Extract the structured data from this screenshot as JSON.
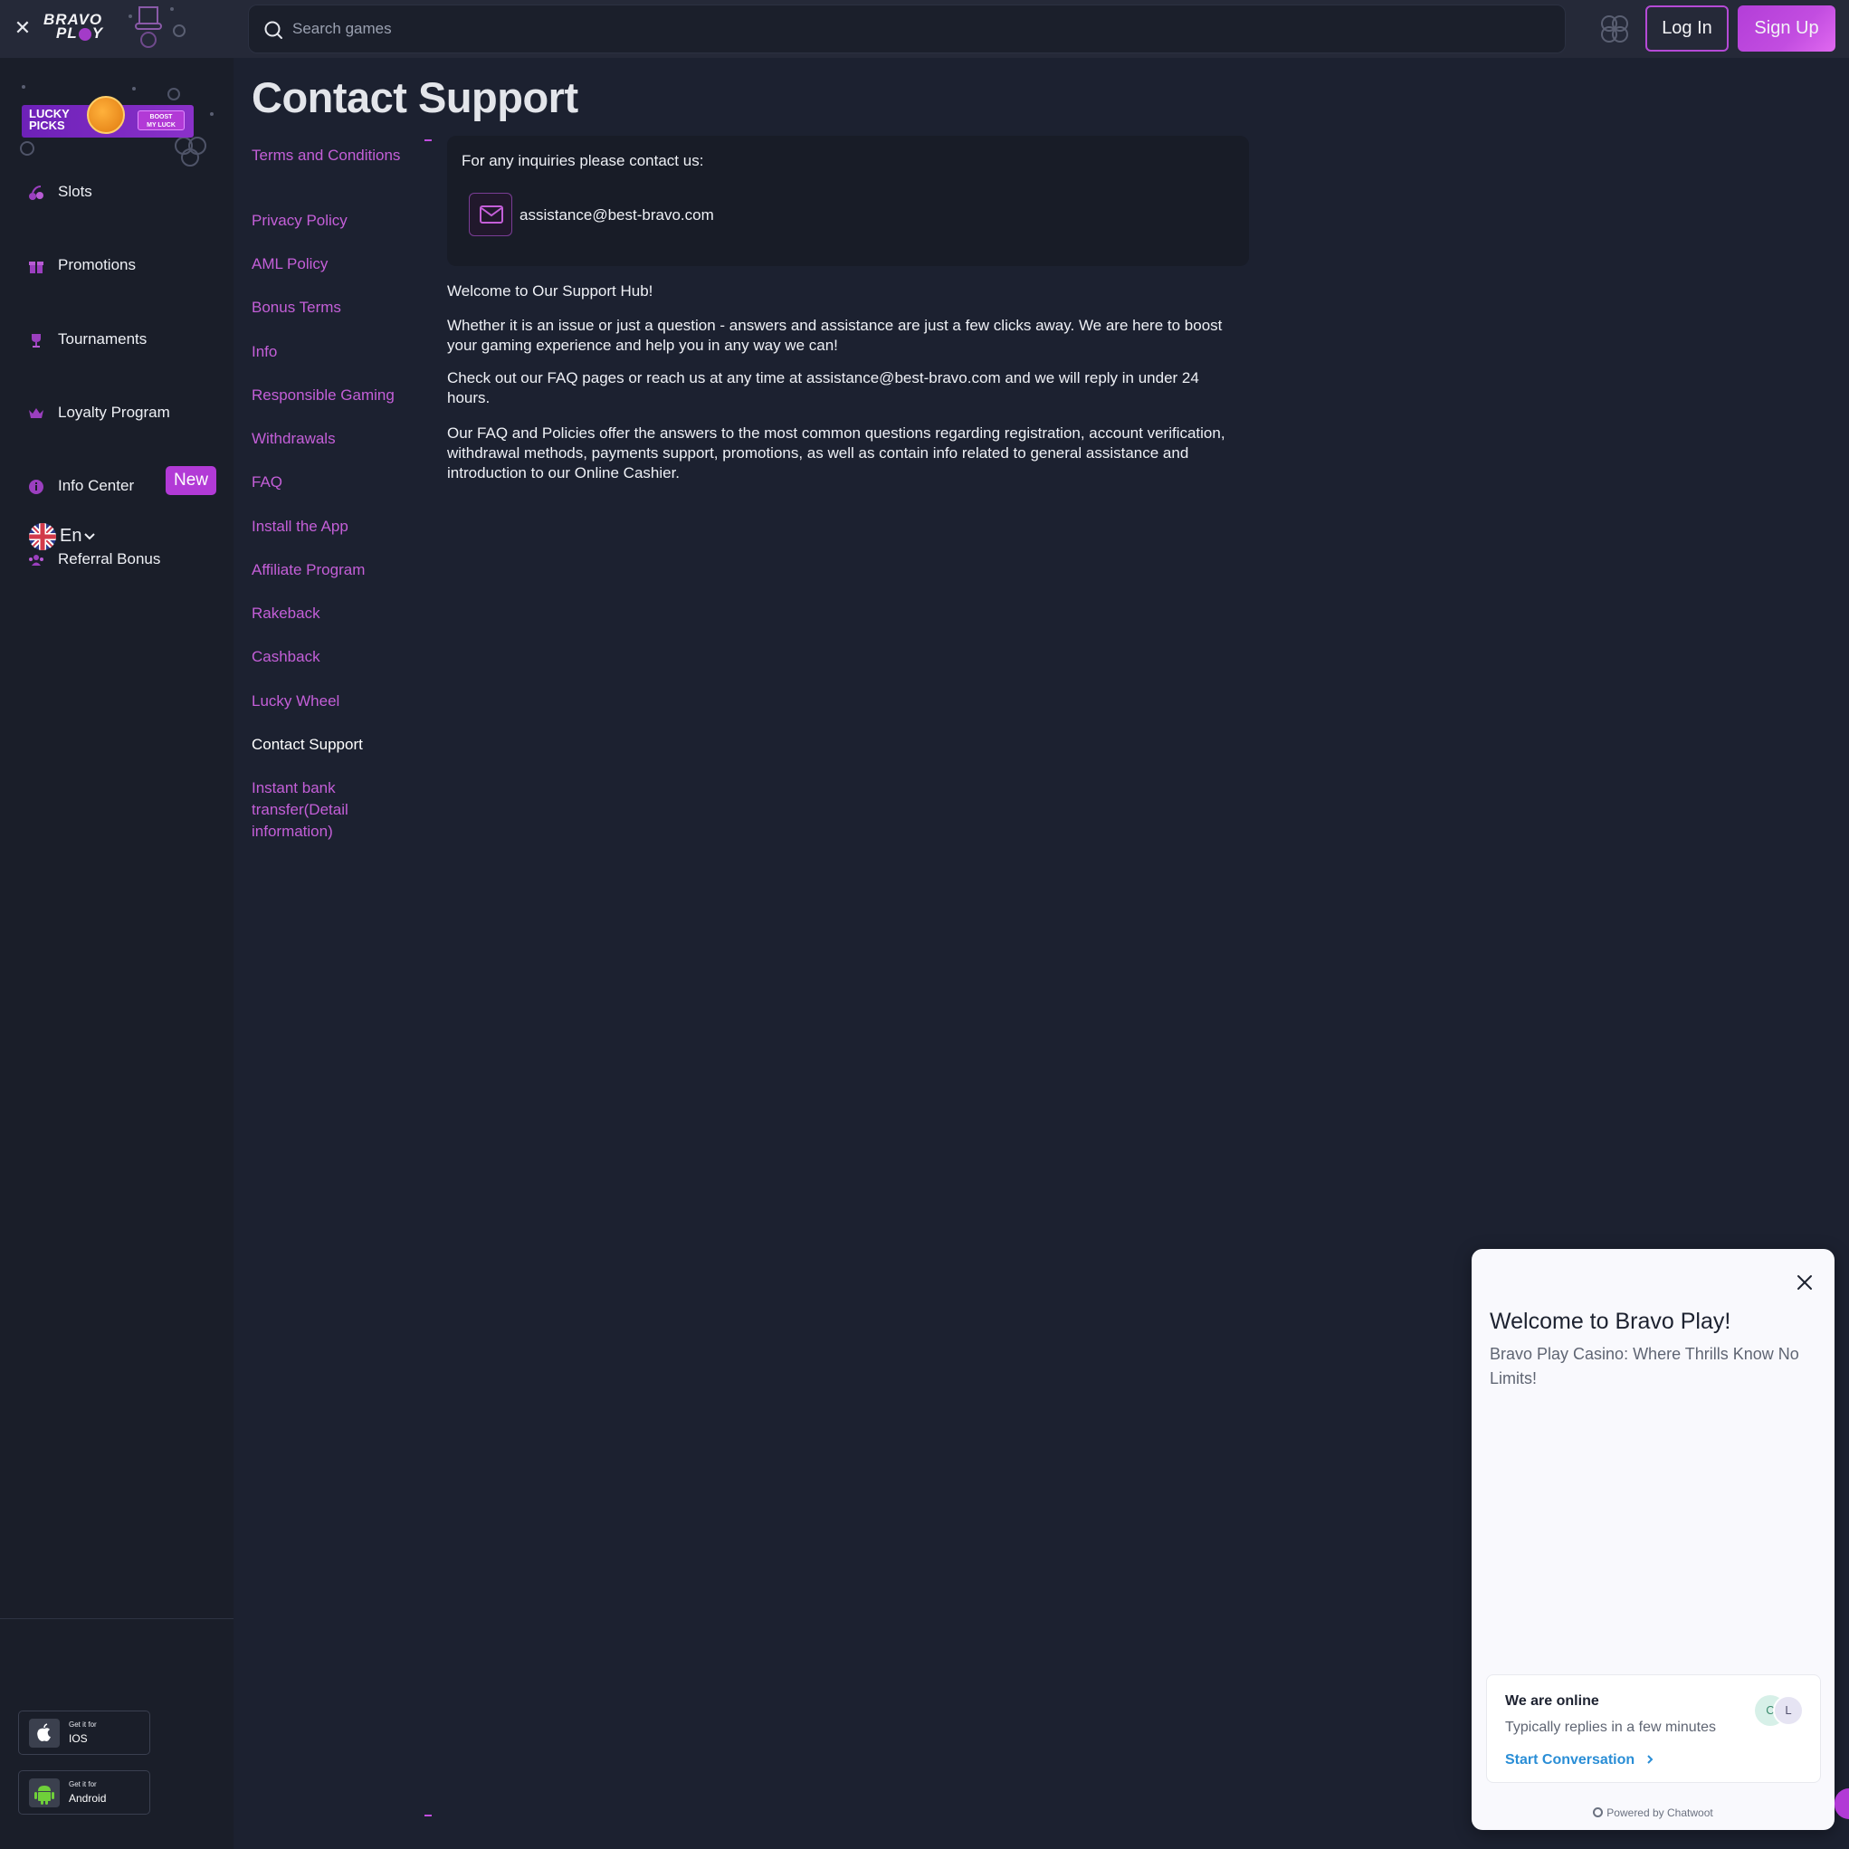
{
  "header": {
    "logo_line1": "BRAVO",
    "logo_line2_a": "PL",
    "logo_line2_b": "Y",
    "search_placeholder": "Search games",
    "login_label": "Log In",
    "signup_label": "Sign Up"
  },
  "sidebar": {
    "banner": {
      "title_line1": "LUCKY",
      "title_line2": "PICKS",
      "boost_line1": "BOOST",
      "boost_line2": "MY LUCK"
    },
    "items": [
      {
        "label": "Slots",
        "icon": "cherry-icon"
      },
      {
        "label": "Promotions",
        "icon": "gift-icon"
      },
      {
        "label": "Tournaments",
        "icon": "trophy-icon"
      },
      {
        "label": "Loyalty Program",
        "icon": "crown-icon"
      },
      {
        "label": "Info Center",
        "icon": "info-icon"
      },
      {
        "label": "Referral Bonus",
        "icon": "users-icon"
      }
    ],
    "referral_badge": "New",
    "language": "En",
    "stores": [
      {
        "small": "Get it for",
        "big": "IOS",
        "icon": "apple-icon"
      },
      {
        "small": "Get it for",
        "big": "Android",
        "icon": "android-icon"
      }
    ]
  },
  "main": {
    "title": "Contact Support",
    "policy_links": [
      "Terms and Conditions",
      "Privacy Policy",
      "AML Policy",
      "Bonus Terms",
      "Info",
      "Responsible Gaming",
      "Withdrawals",
      "FAQ",
      "Install the App",
      "Affiliate Program",
      "Rakeback",
      "Cashback",
      "Lucky Wheel",
      "Contact Support",
      "Instant bank transfer(Detail information)"
    ],
    "active_link": "Contact Support",
    "contact": {
      "intro": "For any inquiries please contact us:",
      "email": "assistance@best-bravo.com"
    },
    "paragraphs": [
      "Welcome to Our Support Hub!",
      "Whether it is an issue or just a question - answers and assistance are just a few clicks away. We are here to boost your gaming experience and help you in any way we can!",
      "Check out our FAQ pages or reach us at any time at assistance@best-bravo.com and we will reply in under 24 hours.",
      "Our FAQ and Policies offer the answers to the most common questions regarding registration, account verification, withdrawal methods, payments support, promotions, as well as contain info related to general assistance and introduction to our Online Cashier."
    ]
  },
  "chat": {
    "title": "Welcome to Bravo Play!",
    "subtitle": "Bravo Play Casino: Where Thrills Know No Limits!",
    "online_title": "We are online",
    "online_sub": "Typically replies in a few minutes",
    "start_label": "Start Conversation",
    "avatars": [
      "C",
      "L"
    ],
    "powered_by": "Powered by Chatwoot"
  },
  "colors": {
    "accent": "#b23ad6",
    "link": "#c45fd8",
    "background": "#1c2130",
    "sidebar": "#1a1e29",
    "chat_link": "#2a8ed6"
  }
}
